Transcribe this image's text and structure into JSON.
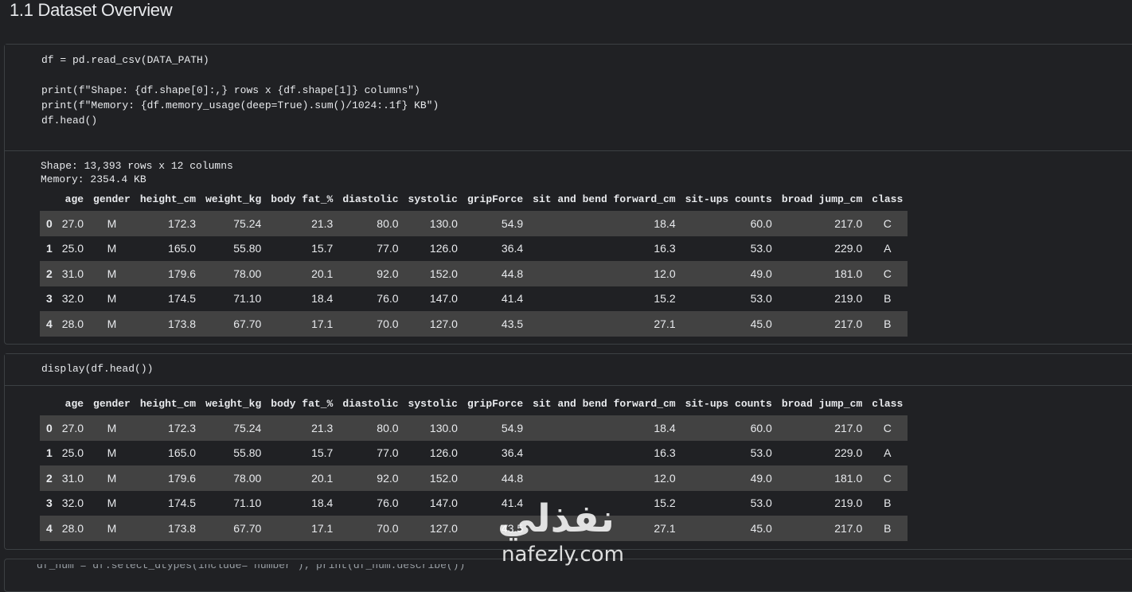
{
  "section_title": "1.1 Dataset Overview",
  "cell1": {
    "code_lines": [
      "df = pd.read_csv(DATA_PATH)",
      "",
      "print(f\"Shape: {df.shape[0]:,} rows x {df.shape[1]} columns\")",
      "print(f\"Memory: {df.memory_usage(deep=True).sum()/1024:.1f} KB\")",
      "df.head()"
    ],
    "output_lines": [
      "Shape: 13,393 rows x 12 columns",
      "Memory: 2354.4 KB"
    ]
  },
  "cell2": {
    "code_lines": [
      "display(df.head())"
    ]
  },
  "dataframe": {
    "columns": [
      "",
      "age",
      "gender",
      "height_cm",
      "weight_kg",
      "body fat_%",
      "diastolic",
      "systolic",
      "gripForce",
      "sit and bend forward_cm",
      "sit-ups counts",
      "broad jump_cm",
      "class"
    ],
    "rows": [
      [
        "0",
        "27.0",
        "M",
        "172.3",
        "75.24",
        "21.3",
        "80.0",
        "130.0",
        "54.9",
        "18.4",
        "60.0",
        "217.0",
        "C"
      ],
      [
        "1",
        "25.0",
        "M",
        "165.0",
        "55.80",
        "15.7",
        "77.0",
        "126.0",
        "36.4",
        "16.3",
        "53.0",
        "229.0",
        "A"
      ],
      [
        "2",
        "31.0",
        "M",
        "179.6",
        "78.00",
        "20.1",
        "92.0",
        "152.0",
        "44.8",
        "12.0",
        "49.0",
        "181.0",
        "C"
      ],
      [
        "3",
        "32.0",
        "M",
        "174.5",
        "71.10",
        "18.4",
        "76.0",
        "147.0",
        "41.4",
        "15.2",
        "53.0",
        "219.0",
        "B"
      ],
      [
        "4",
        "28.0",
        "M",
        "173.8",
        "67.70",
        "17.1",
        "70.0",
        "127.0",
        "43.5",
        "27.1",
        "45.0",
        "217.0",
        "B"
      ]
    ]
  },
  "watermark": {
    "arabic": "نفذلي",
    "latin": "nafezly.com"
  },
  "next_cell_partial": "df_num = df.select_dtypes(include='number'); print(df_num.describe())",
  "colors": {
    "background": "#202124",
    "row_stripe": "#424242",
    "cell_border": "#3c4043"
  }
}
